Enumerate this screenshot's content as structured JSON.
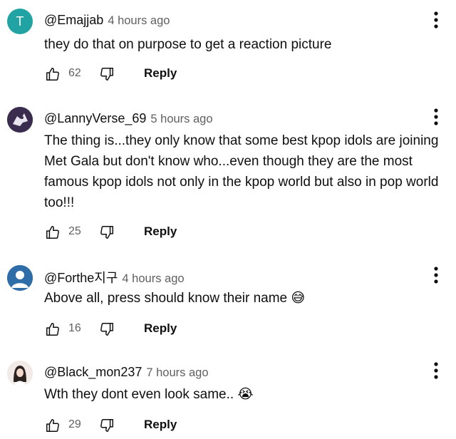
{
  "comments": [
    {
      "avatar_letter": "T",
      "avatar_color": "#21a3a3",
      "author": "@Emajjab",
      "time": "4 hours ago",
      "text": "they do that on purpose to get a reaction picture",
      "emoji": "",
      "likes": "62",
      "reply_label": "Reply"
    },
    {
      "avatar_letter": "",
      "avatar_color": "#3a2c4f",
      "author": "@LannyVerse_69",
      "time": "5 hours ago",
      "text": "The thing is...they only know that some best kpop idols are joining Met Gala but don't know who...even though they are the most famous kpop idols not only in the kpop world but also in pop world too!!!",
      "emoji": "",
      "likes": "25",
      "reply_label": "Reply"
    },
    {
      "avatar_letter": "",
      "avatar_color": "#2e6da8",
      "author": "@Forthe지구",
      "time": "4 hours ago",
      "text": "Above all, press should know their name",
      "emoji": "😅",
      "likes": "16",
      "reply_label": "Reply"
    },
    {
      "avatar_letter": "",
      "avatar_color": "#f1eae6",
      "author": "@Black_mon237",
      "time": "7 hours ago",
      "text": "Wth they dont even look same..",
      "emoji": "😭",
      "likes": "29",
      "reply_label": "Reply"
    }
  ],
  "icons": {
    "like": "thumbs-up-icon",
    "dislike": "thumbs-down-icon",
    "menu": "more-vertical-icon"
  },
  "colors": {
    "author_text": "#0f0f0f",
    "meta_text": "#606060"
  }
}
